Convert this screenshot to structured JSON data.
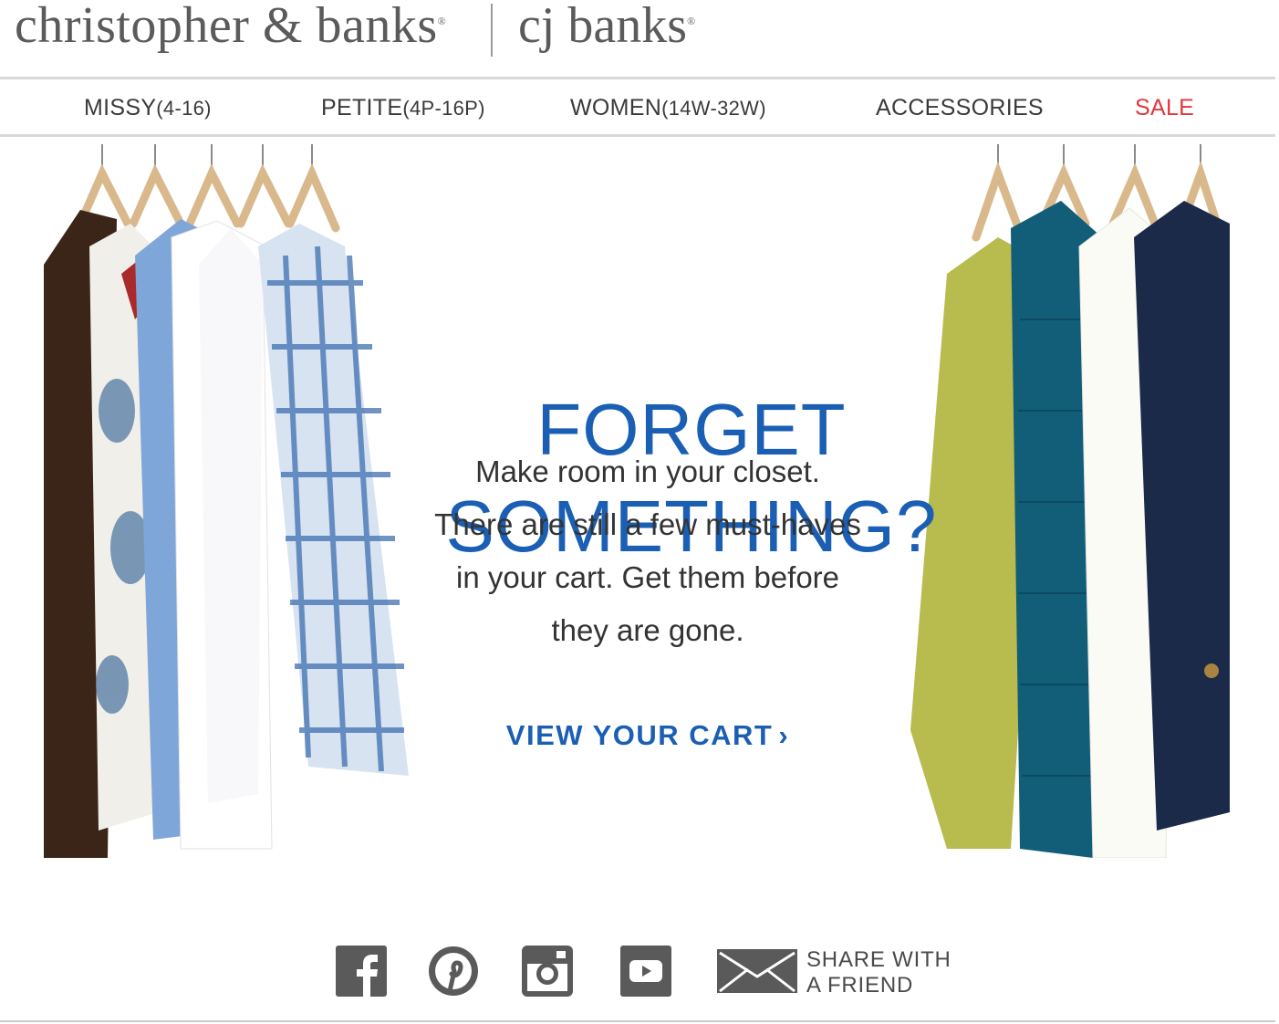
{
  "header": {
    "brand_main": "christopher & banks",
    "brand_secondary": "cj banks",
    "registered_mark": "®"
  },
  "nav": {
    "items": [
      {
        "label": "MISSY",
        "size": "(4-16)"
      },
      {
        "label": "PETITE",
        "size": "(4P-16P)"
      },
      {
        "label": "WOMEN",
        "size": "(14W-32W)"
      },
      {
        "label": "ACCESSORIES",
        "size": ""
      },
      {
        "label": "SALE",
        "size": ""
      }
    ]
  },
  "hero": {
    "headline_line1": "FORGET",
    "headline_line2": "SOMETHING?",
    "body_lines": [
      "Make room in your closet.",
      "There are still a few must-haves",
      "in your cart. Get them before",
      "they are gone."
    ],
    "cta_label": "VIEW YOUR CART",
    "cta_chevron": "›"
  },
  "social": {
    "share_line1": "SHARE WITH",
    "share_line2": "A FRIEND"
  },
  "colors": {
    "brand_blue": "#1a5fb4",
    "sale_red": "#e2363d",
    "icon_gray": "#5a5a5a",
    "text_gray": "#333333"
  }
}
